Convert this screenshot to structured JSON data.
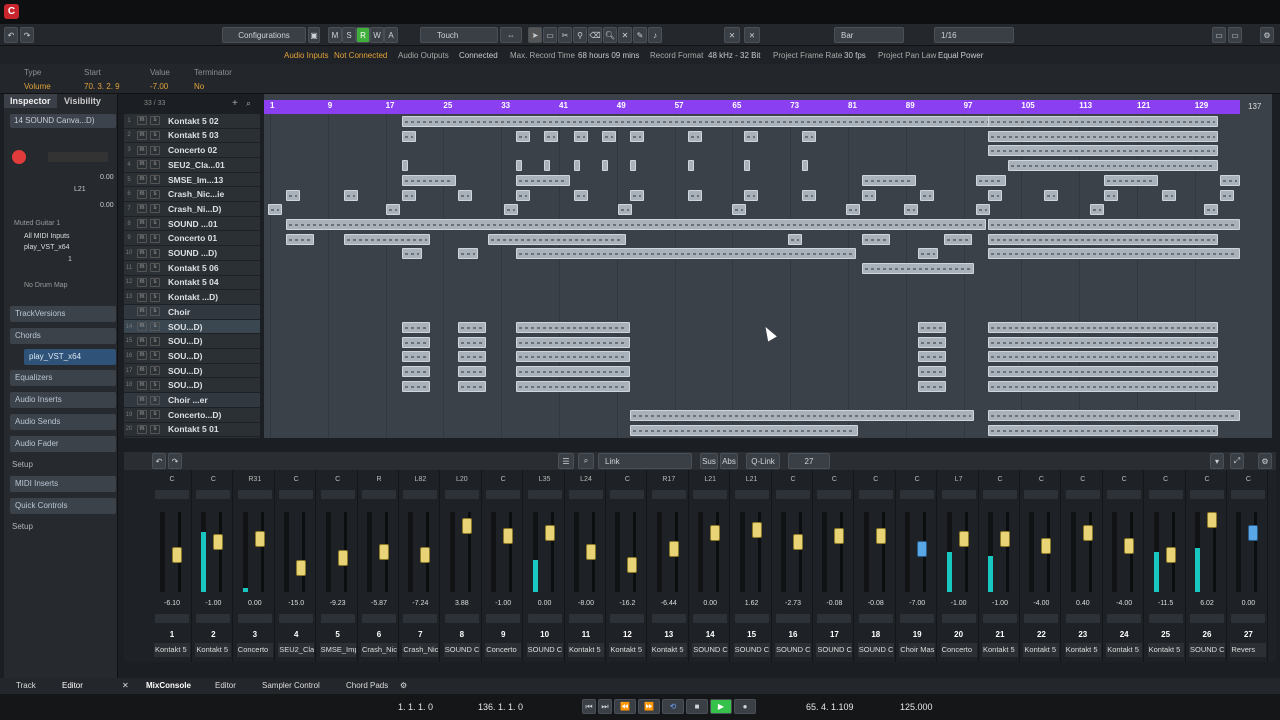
{
  "toolbar": {
    "configurations_label": "Configurations",
    "mode_letters": [
      "M",
      "S",
      "R",
      "W",
      "A"
    ],
    "automation_mode": "Touch",
    "snap_type": "Bar",
    "quantize": "1/16"
  },
  "status": {
    "audio_inputs_label": "Audio Inputs",
    "audio_inputs_value": "Not Connected",
    "audio_outputs_label": "Audio Outputs",
    "audio_outputs_value": "Connected",
    "max_record_label": "Max. Record Time",
    "max_record_value": "68 hours 09 mins",
    "record_format_label": "Record Format",
    "record_format_value": "48 kHz - 32 Bit",
    "frame_rate_label": "Project Frame Rate",
    "frame_rate_value": "30 fps",
    "pan_law_label": "Project Pan Law",
    "pan_law_value": "Equal Power"
  },
  "infoline": {
    "type_label": "Type",
    "type_value": "Volume",
    "start_label": "Start",
    "start_value": "70. 3. 2. 9",
    "value_label": "Value",
    "value_value": "-7.00",
    "terminator_label": "Terminator",
    "terminator_value": "No"
  },
  "inspector": {
    "tab_inspector": "Inspector",
    "tab_visibility": "Visibility",
    "track_name": "SOUND Canva...D)",
    "track_num": "14",
    "vol_value": "0.00",
    "pan_value": "L21",
    "val2": "0.00",
    "list": [
      "Muted Guitar 1",
      "All MIDI Inputs",
      "play_VST_x64",
      "No Drum Map"
    ],
    "channel_num": "1",
    "sections": [
      "TrackVersions",
      "Chords",
      "play_VST_x64",
      "Equalizers",
      "Audio Inserts",
      "Audio Sends",
      "Audio Fader",
      "Setup",
      "MIDI Inserts",
      "Quick Controls",
      "Setup"
    ]
  },
  "project": {
    "track_count": "33 / 33",
    "end_marker": "137",
    "ruler": [
      "1",
      "9",
      "17",
      "25",
      "33",
      "41",
      "49",
      "57",
      "65",
      "73",
      "81",
      "89",
      "97",
      "105",
      "113",
      "121",
      "129"
    ]
  },
  "tracks": [
    {
      "n": "1",
      "name": "Kontakt 5 02"
    },
    {
      "n": "2",
      "name": "Kontakt 5 03"
    },
    {
      "n": "3",
      "name": "Concerto 02"
    },
    {
      "n": "4",
      "name": "SEU2_Cla...01"
    },
    {
      "n": "5",
      "name": "SMSE_Im...13"
    },
    {
      "n": "6",
      "name": "Crash_Nic...ie"
    },
    {
      "n": "7",
      "name": "Crash_Ni...D)"
    },
    {
      "n": "8",
      "name": "SOUND ...01"
    },
    {
      "n": "9",
      "name": "Concerto 01"
    },
    {
      "n": "10",
      "name": "SOUND ...D)"
    },
    {
      "n": "11",
      "name": "Kontakt 5 06"
    },
    {
      "n": "12",
      "name": "Kontakt 5 04"
    },
    {
      "n": "13",
      "name": "Kontakt ...D)"
    },
    {
      "n": "",
      "name": "Choir"
    },
    {
      "n": "14",
      "name": "SOU...D)"
    },
    {
      "n": "15",
      "name": "SOU...D)"
    },
    {
      "n": "16",
      "name": "SOU...D)"
    },
    {
      "n": "17",
      "name": "SOU...D)"
    },
    {
      "n": "18",
      "name": "SOU...D)"
    },
    {
      "n": "",
      "name": "Choir ...er"
    },
    {
      "n": "19",
      "name": "Concerto...D)"
    },
    {
      "n": "20",
      "name": "Kontakt 5 01"
    }
  ],
  "lower": {
    "link_label": "Link",
    "sus_label": "Sus",
    "abs_label": "Abs",
    "qlink_label": "Q-Link",
    "count": "27"
  },
  "mixer": [
    {
      "n": "1",
      "pan": "C",
      "db": "-6.10",
      "name": "Kontakt 5",
      "meter": 0,
      "f": 0.55
    },
    {
      "n": "2",
      "pan": "C",
      "db": "-1.00",
      "name": "Kontakt 5",
      "meter": 0.75,
      "f": 0.35
    },
    {
      "n": "3",
      "pan": "R31",
      "db": "0.00",
      "name": "Concerto",
      "meter": 0.05,
      "f": 0.3
    },
    {
      "n": "4",
      "pan": "C",
      "db": "-15.0",
      "name": "SEU2_Clar",
      "meter": 0,
      "f": 0.75
    },
    {
      "n": "5",
      "pan": "C",
      "db": "-9.23",
      "name": "SMSE_Imp",
      "meter": 0,
      "f": 0.6
    },
    {
      "n": "6",
      "pan": "R",
      "db": "-5.87",
      "name": "Crash_Nic",
      "meter": 0,
      "f": 0.5
    },
    {
      "n": "7",
      "pan": "L82",
      "db": "-7.24",
      "name": "Crash_Nic",
      "meter": 0,
      "f": 0.55
    },
    {
      "n": "8",
      "pan": "L20",
      "db": "3.88",
      "name": "SOUND C",
      "meter": 0,
      "f": 0.1
    },
    {
      "n": "9",
      "pan": "C",
      "db": "-1.00",
      "name": "Concerto",
      "meter": 0,
      "f": 0.25
    },
    {
      "n": "10",
      "pan": "L35",
      "db": "0.00",
      "name": "SOUND C",
      "meter": 0.4,
      "f": 0.2
    },
    {
      "n": "11",
      "pan": "L24",
      "db": "-8.00",
      "name": "Kontakt 5",
      "meter": 0,
      "f": 0.5
    },
    {
      "n": "12",
      "pan": "C",
      "db": "-16.2",
      "name": "Kontakt 5",
      "meter": 0,
      "f": 0.7
    },
    {
      "n": "13",
      "pan": "R17",
      "db": "-6.44",
      "name": "Kontakt 5",
      "meter": 0,
      "f": 0.45
    },
    {
      "n": "14",
      "pan": "L21",
      "db": "0.00",
      "name": "SOUND C",
      "meter": 0,
      "f": 0.2
    },
    {
      "n": "15",
      "pan": "L21",
      "db": "1.62",
      "name": "SOUND C",
      "meter": 0,
      "f": 0.15
    },
    {
      "n": "16",
      "pan": "C",
      "db": "-2.73",
      "name": "SOUND C",
      "meter": 0,
      "f": 0.35
    },
    {
      "n": "17",
      "pan": "C",
      "db": "-0.08",
      "name": "SOUND C",
      "meter": 0,
      "f": 0.25
    },
    {
      "n": "18",
      "pan": "C",
      "db": "-0.08",
      "name": "SOUND C",
      "meter": 0,
      "f": 0.25
    },
    {
      "n": "19",
      "pan": "C",
      "db": "-7.00",
      "name": "Choir Mas",
      "meter": 0,
      "f": 0.45,
      "blue": true
    },
    {
      "n": "20",
      "pan": "L7",
      "db": "-1.00",
      "name": "Concerto",
      "meter": 0.5,
      "f": 0.3
    },
    {
      "n": "21",
      "pan": "C",
      "db": "-1.00",
      "name": "Kontakt 5",
      "meter": 0.45,
      "f": 0.3
    },
    {
      "n": "22",
      "pan": "C",
      "db": "-4.00",
      "name": "Kontakt 5",
      "meter": 0,
      "f": 0.4
    },
    {
      "n": "23",
      "pan": "C",
      "db": "0.40",
      "name": "Kontakt 5",
      "meter": 0,
      "f": 0.2
    },
    {
      "n": "24",
      "pan": "C",
      "db": "-4.00",
      "name": "Kontakt 5",
      "meter": 0,
      "f": 0.4
    },
    {
      "n": "25",
      "pan": "C",
      "db": "-11.5",
      "name": "Kontakt 5",
      "meter": 0.5,
      "f": 0.55
    },
    {
      "n": "26",
      "pan": "C",
      "db": "6.02",
      "name": "SOUND C",
      "meter": 0.55,
      "f": 0.0
    },
    {
      "n": "27",
      "pan": "C",
      "db": "0.00",
      "name": "Revers",
      "meter": 0,
      "f": 0.2,
      "blue": true
    }
  ],
  "bottom_tabs": {
    "track": "Track",
    "editor": "Editor",
    "mixconsole": "MixConsole",
    "editor2": "Editor",
    "sampler": "Sampler Control",
    "chordpads": "Chord Pads"
  },
  "transport": {
    "left_locator": "1. 1. 1.   0",
    "right_locator": "136. 1. 1.   0",
    "position": "65.  4.  1.109",
    "tempo": "125.000"
  },
  "colors": {
    "ruler": "#8a3ff0",
    "record": "#e23b3b",
    "play": "#36c24a",
    "meter": "#18c7c0"
  }
}
